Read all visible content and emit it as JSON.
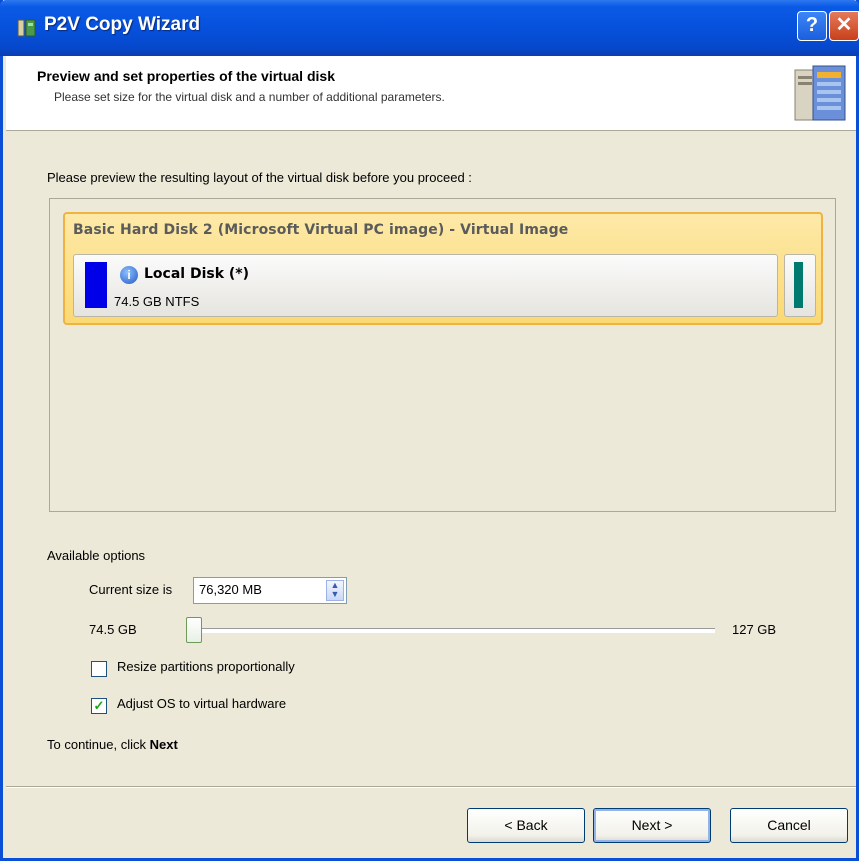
{
  "window": {
    "title": "P2V Copy Wizard",
    "help_glyph": "?",
    "close_glyph": "✕"
  },
  "header": {
    "title": "Preview and set properties of the virtual disk",
    "subtitle": "Please set size for the virtual disk and a number of additional parameters."
  },
  "preview": {
    "label": "Please preview the resulting layout of the virtual disk before you proceed :",
    "disk_title": "Basic Hard Disk 2 (Microsoft Virtual PC image) - Virtual Image",
    "partition": {
      "name": "Local Disk (*)",
      "size": "74.5 GB NTFS",
      "color": "#0000e8"
    },
    "unallocated_color": "#007a6e"
  },
  "options": {
    "label": "Available options",
    "size_label": "Current size is",
    "size_value": "76,320 MB",
    "slider_min": "74.5 GB",
    "slider_max": "127 GB",
    "slider_position": 0.0,
    "resize_label": "Resize partitions proportionally",
    "resize_checked": false,
    "adjust_label": "Adjust OS to virtual hardware",
    "adjust_checked": true,
    "check_glyph": "✓"
  },
  "footer": {
    "continue_prefix": "To continue, click ",
    "continue_bold": "Next",
    "back_label": "< Back",
    "next_label": "Next >",
    "cancel_label": "Cancel"
  }
}
